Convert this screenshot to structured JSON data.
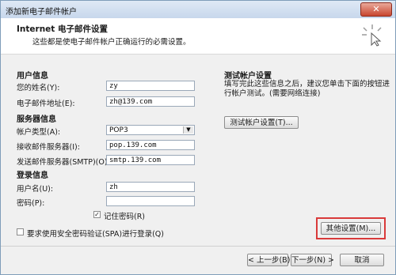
{
  "window": {
    "title": "添加新电子邮件帐户",
    "close_label": "✕"
  },
  "header": {
    "title": "Internet 电子邮件设置",
    "subtitle": "这些都是使电子邮件帐户正确运行的必需设置。"
  },
  "user_info": {
    "heading": "用户信息",
    "name_label": "您的姓名(Y):",
    "name_value": "zy",
    "email_label": "电子邮件地址(E):",
    "email_value": "zh@139.com"
  },
  "server_info": {
    "heading": "服务器信息",
    "account_type_label": "帐户类型(A):",
    "account_type_value": "POP3",
    "incoming_label": "接收邮件服务器(I):",
    "incoming_value": "pop.139.com",
    "outgoing_label": "发送邮件服务器(SMTP)(O):",
    "outgoing_value": "smtp.139.com"
  },
  "login_info": {
    "heading": "登录信息",
    "username_label": "用户名(U):",
    "username_value": "zh",
    "password_label": "密码(P):",
    "password_value": "",
    "remember_label": "记住密码(R)",
    "remember_checked": true,
    "spa_label": "要求使用安全密码验证(SPA)进行登录(Q)",
    "spa_checked": false
  },
  "test_settings": {
    "heading": "测试帐户设置",
    "description_line1": "填写完此这些信息之后，建议您单击下面的按钮进",
    "description_line2": "行帐户测试。(需要网络连接)",
    "test_button": "测试帐户设置(T)..."
  },
  "buttons": {
    "more_settings": "其他设置(M)...",
    "back": "< 上一步(B)",
    "next": "下一步(N) >",
    "cancel": "取消"
  },
  "colors": {
    "highlight": "#d93a3a"
  }
}
